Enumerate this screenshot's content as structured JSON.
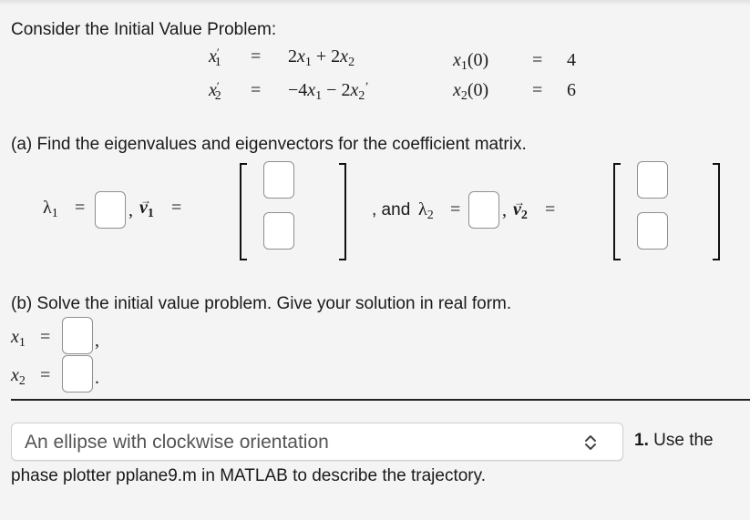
{
  "intro": "Consider the Initial Value Problem:",
  "system": {
    "eq1": {
      "lhs_var": "x",
      "lhs_sub": "1",
      "lhs_prime": "′",
      "eq": "=",
      "rhs": [
        "2",
        "x",
        "1",
        " + 2",
        "x",
        "2"
      ]
    },
    "eq2": {
      "lhs_var": "x",
      "lhs_sub": "2",
      "lhs_prime": "′",
      "eq": "=",
      "rhs": [
        "−4",
        "x",
        "1",
        " − 2",
        "x",
        "2"
      ],
      "trailing": "’"
    },
    "ic1": {
      "var": "x",
      "sub": "1",
      "arg": "(0)",
      "eq": "=",
      "value": "4"
    },
    "ic2": {
      "var": "x",
      "sub": "2",
      "arg": "(0)",
      "eq": "=",
      "value": "6"
    }
  },
  "part_a": {
    "prompt": "(a) Find the eigenvalues and eigenvectors for the coefficient matrix.",
    "lambda1_label": "λ",
    "lambda1_sub": "1",
    "eq": "=",
    "comma": ",",
    "v1_label": "v",
    "v1_sub": "1",
    "arrow": "→",
    "and_label": ", and",
    "lambda2_label": "λ",
    "lambda2_sub": "2",
    "v2_label": "v",
    "v2_sub": "2",
    "answers": {
      "lambda1": "",
      "v1": [
        "",
        ""
      ],
      "lambda2": "",
      "v2": [
        "",
        ""
      ]
    }
  },
  "part_b": {
    "prompt": "(b) Solve the initial value problem. Give your solution in real form.",
    "x1_label": "x",
    "x1_sub": "1",
    "x2_label": "x",
    "x2_sub": "2",
    "eq": "=",
    "x1_punct": ",",
    "x2_punct": ".",
    "answers": {
      "x1": "",
      "x2": ""
    }
  },
  "question1": {
    "select_value": "An ellipse with clockwise orientation",
    "number": "1.",
    "text_a": "Use the",
    "text_b": "phase plotter pplane9.m in MATLAB to describe the trajectory."
  }
}
